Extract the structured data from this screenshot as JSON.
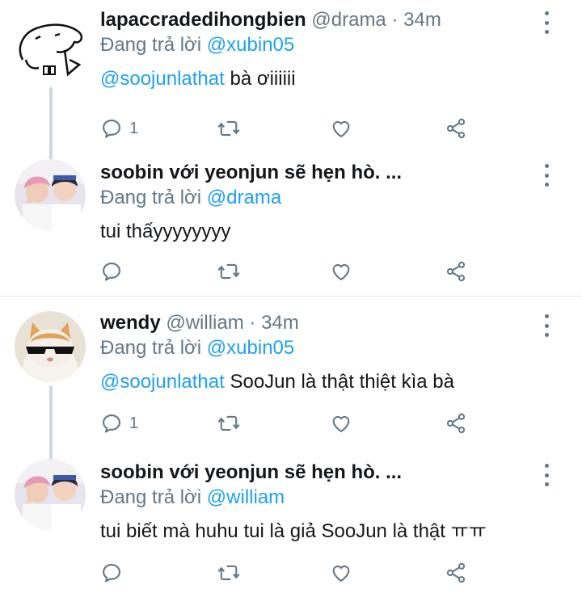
{
  "tweets": [
    {
      "name": "lapaccradedihongbien",
      "handle": "@drama",
      "separator": "·",
      "time": "34m",
      "reply_prefix": "Đang trả lời",
      "reply_to": "@xubin05",
      "mention": "@soojunlathat",
      "text": " bà ơiiiiii",
      "reply_count": "1"
    },
    {
      "name": "soobin với yeonjun sẽ hẹn hò. ...",
      "reply_prefix": "Đang trả lời",
      "reply_to": "@drama",
      "text": "tui thấyyyyyyyy",
      "reply_count": ""
    },
    {
      "name": "wendy",
      "handle": "@william",
      "separator": "·",
      "time": "34m",
      "reply_prefix": "Đang trả lời",
      "reply_to": "@xubin05",
      "mention": "@soojunlathat",
      "text": " SooJun là thật thiệt kìa bà",
      "reply_count": "1"
    },
    {
      "name": "soobin với yeonjun sẽ hẹn hò. ...",
      "reply_prefix": "Đang trả lời",
      "reply_to": "@william",
      "text": "tui biết mà huhu tui là giả SooJun là thật ㅠㅠ",
      "reply_count": ""
    }
  ],
  "icons": {
    "reply": "reply-icon",
    "retweet": "retweet-icon",
    "like": "heart-icon",
    "share": "share-icon",
    "more": "more-vertical-icon"
  },
  "colors": {
    "link": "#1da1f2",
    "secondary": "#657786",
    "thread_line": "#cfd9de",
    "divider": "#e1e8ed"
  }
}
